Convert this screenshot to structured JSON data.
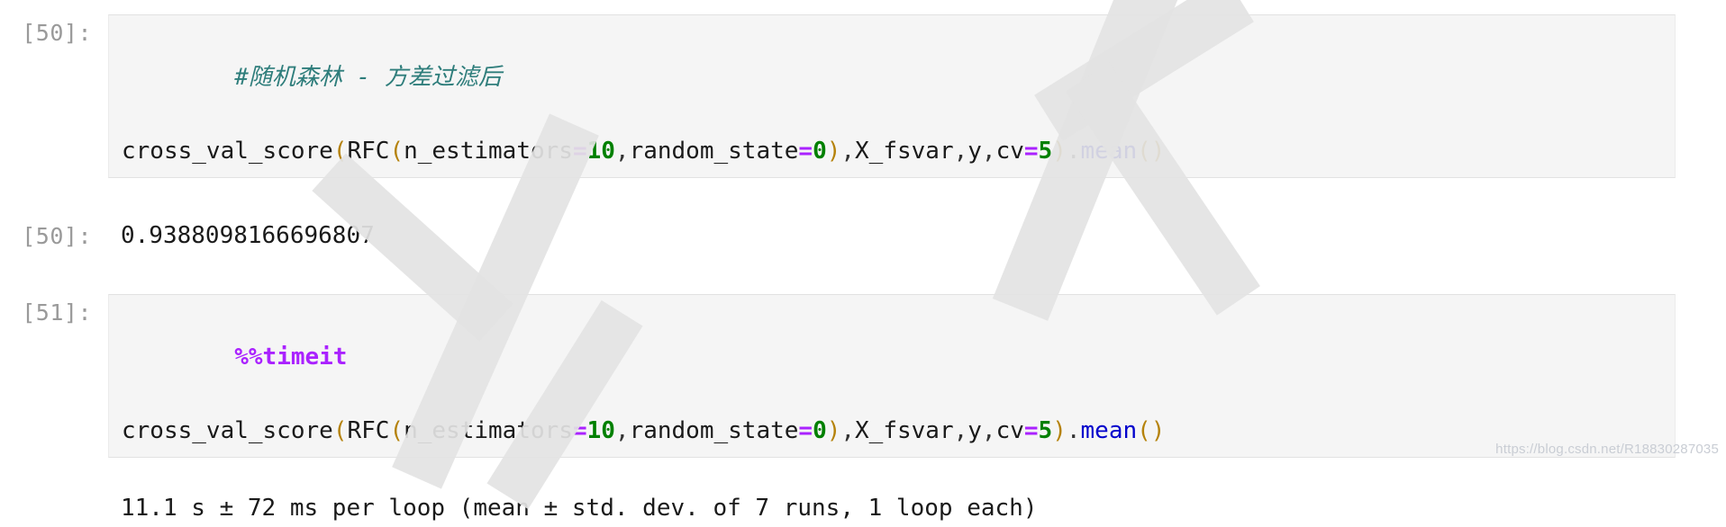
{
  "notebook": {
    "cells": [
      {
        "prompt": "[50]:",
        "type": "code",
        "lines": [
          {
            "kind": "comment",
            "text": "#随机森林 - 方差过滤后"
          },
          {
            "kind": "code",
            "tokens": [
              {
                "t": "cross_val_score",
                "c": "name"
              },
              {
                "t": "(",
                "c": "paren"
              },
              {
                "t": "RFC",
                "c": "name"
              },
              {
                "t": "(",
                "c": "paren"
              },
              {
                "t": "n_estimators",
                "c": "name"
              },
              {
                "t": "=",
                "c": "eq"
              },
              {
                "t": "10",
                "c": "num"
              },
              {
                "t": ",",
                "c": "op"
              },
              {
                "t": "random_state",
                "c": "name"
              },
              {
                "t": "=",
                "c": "eq"
              },
              {
                "t": "0",
                "c": "num"
              },
              {
                "t": ")",
                "c": "paren"
              },
              {
                "t": ",",
                "c": "op"
              },
              {
                "t": "X_fsvar",
                "c": "name"
              },
              {
                "t": ",",
                "c": "op"
              },
              {
                "t": "y",
                "c": "name"
              },
              {
                "t": ",",
                "c": "op"
              },
              {
                "t": "cv",
                "c": "name"
              },
              {
                "t": "=",
                "c": "eq"
              },
              {
                "t": "5",
                "c": "num"
              },
              {
                "t": ")",
                "c": "paren"
              },
              {
                "t": ".",
                "c": "op"
              },
              {
                "t": "mean",
                "c": "attr"
              },
              {
                "t": "()",
                "c": "paren"
              }
            ]
          }
        ]
      }
    ],
    "output_50": {
      "prompt": "[50]:",
      "value": "0.9388098166696807"
    },
    "cell_51": {
      "prompt": "[51]:",
      "magic": "%%timeit"
    },
    "output_51": {
      "text": "11.1 s ± 72 ms per loop (mean ± std. dev. of 7 runs, 1 loop each)"
    }
  },
  "watermark": {
    "url": "https://blog.csdn.net/R18830287035"
  },
  "colors": {
    "cell_background": "#f5f5f5",
    "cell_border": "#e2e2e2",
    "prompt": "#9a9a9a",
    "comment": "#2e7d7b",
    "number": "#008000",
    "operator_eq": "#aa22ff",
    "attribute": "#0000cc",
    "paren": "#b5820a",
    "text": "#1a1a1a",
    "watermark": "#e3e3e3"
  }
}
